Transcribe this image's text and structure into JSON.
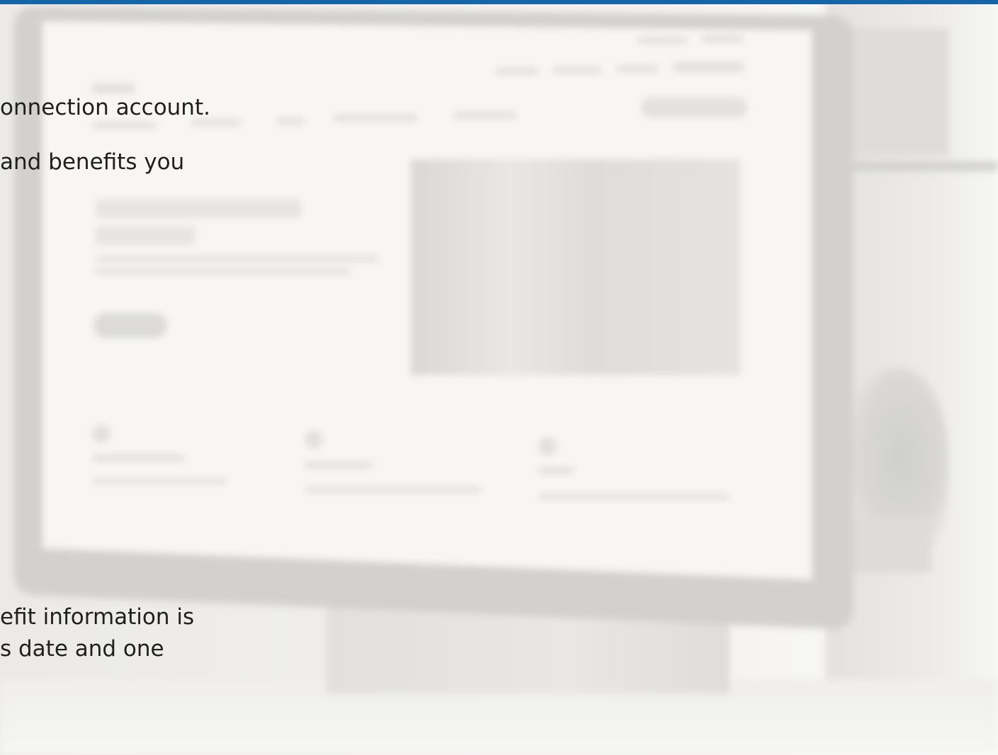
{
  "text": {
    "line_1": "onnection account.",
    "line_2": "and benefits you",
    "line_3": "efit information is",
    "line_4": "s date and one"
  },
  "colors": {
    "top_bar": "#1565a8",
    "text": "#1f1f1f"
  }
}
